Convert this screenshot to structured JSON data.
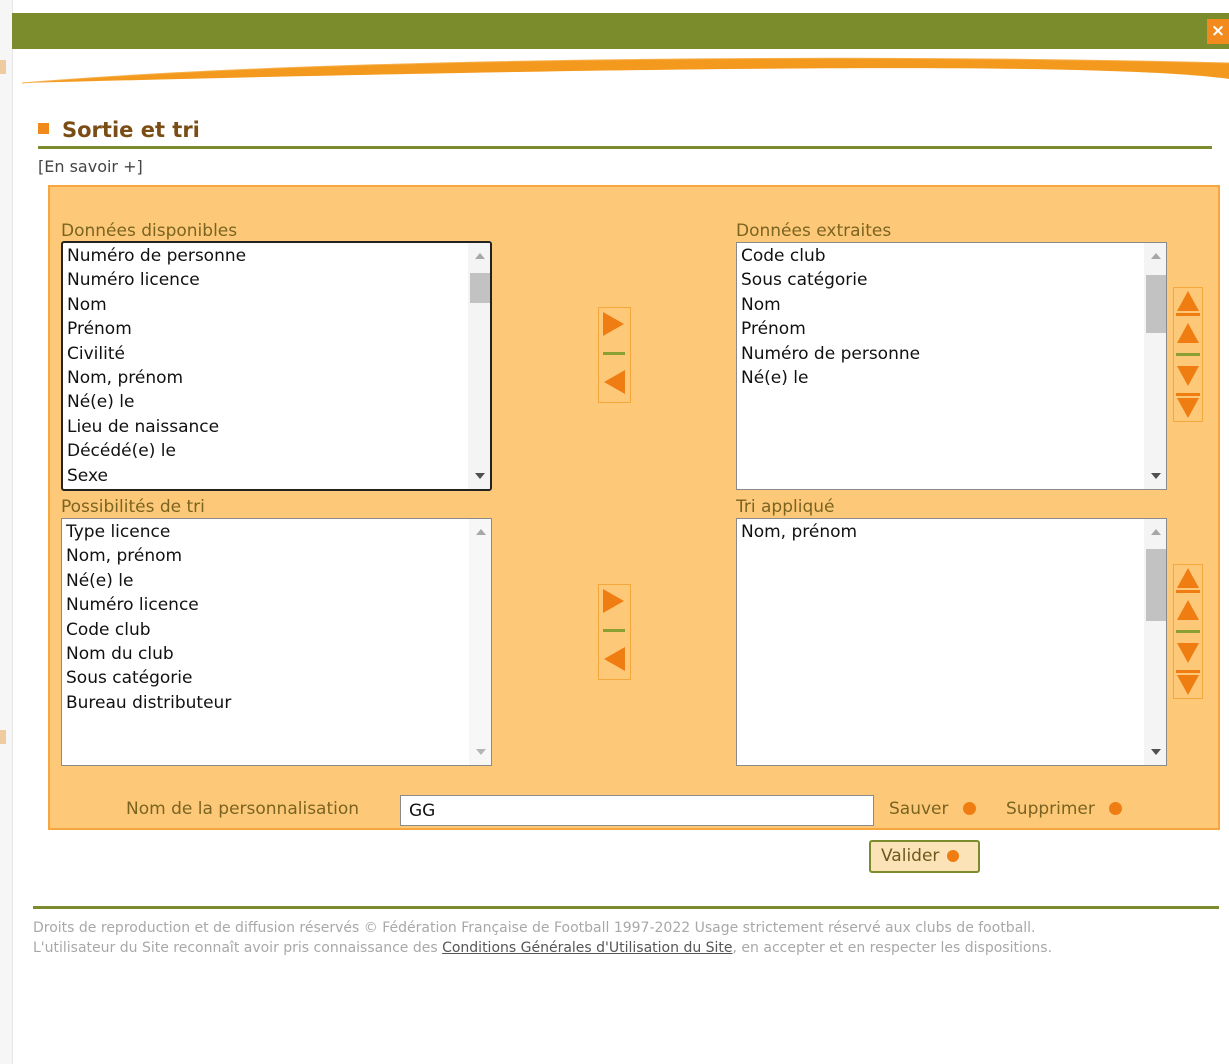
{
  "window": {
    "close_label": "×"
  },
  "section": {
    "title": "Sortie et tri",
    "more_link": "[En savoir +]"
  },
  "lists": {
    "available": {
      "label": "Données disponibles",
      "items": [
        "Numéro de personne",
        "Numéro licence",
        "Nom",
        "Prénom",
        "Civilité",
        "Nom, prénom",
        "Né(e) le",
        "Lieu de naissance",
        "Décédé(e) le",
        "Sexe"
      ]
    },
    "extracted": {
      "label": "Données extraites",
      "items": [
        "Code club",
        "Sous catégorie",
        "Nom",
        "Prénom",
        "Numéro de personne",
        "Né(e) le"
      ]
    },
    "sort_options": {
      "label": "Possibilités de tri",
      "items": [
        "Type licence",
        "Nom, prénom",
        "Né(e) le",
        "Numéro licence",
        "Code club",
        "Nom du club",
        "Sous catégorie",
        "Bureau distributeur"
      ]
    },
    "sort_applied": {
      "label": "Tri appliqué",
      "items": [
        "Nom, prénom"
      ]
    }
  },
  "personalisation": {
    "label": "Nom de la personnalisation",
    "value": "GG",
    "save": "Sauver",
    "delete": "Supprimer"
  },
  "validate": "Valider",
  "footer": {
    "line1": "Droits de reproduction et de diffusion réservés © Fédération Française de Football 1997-2022 Usage strictement réservé aux clubs de football.",
    "line2_pre": "L'utilisateur du Site reconnaît avoir pris connaissance des ",
    "line2_link": "Conditions Générales d'Utilisation du Site",
    "line2_post": ", en accepter et en respecter les dispositions."
  },
  "colors": {
    "header_green": "#7b8c2d",
    "panel_orange": "#fdc979",
    "accent_orange": "#f07d12",
    "title_brown": "#7a4d14"
  }
}
